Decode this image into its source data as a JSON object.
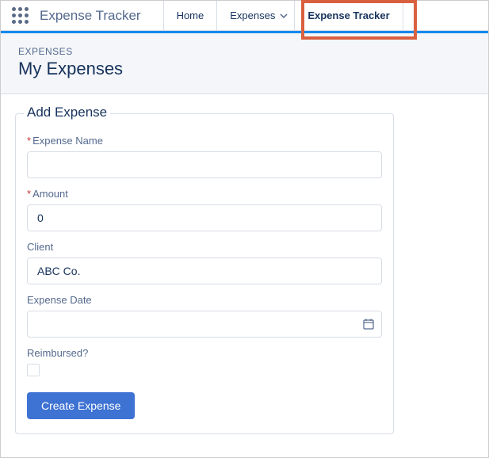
{
  "app": {
    "name": "Expense Tracker"
  },
  "nav": {
    "tabs": [
      {
        "label": "Home"
      },
      {
        "label": "Expenses"
      },
      {
        "label": "Expense Tracker"
      }
    ]
  },
  "pageHeader": {
    "eyebrow": "EXPENSES",
    "title": "My Expenses"
  },
  "form": {
    "legend": "Add Expense",
    "fields": {
      "expenseName": {
        "label": "Expense Name",
        "value": ""
      },
      "amount": {
        "label": "Amount",
        "value": "0"
      },
      "client": {
        "label": "Client",
        "value": "ABC Co."
      },
      "expenseDate": {
        "label": "Expense Date",
        "value": ""
      },
      "reimbursed": {
        "label": "Reimbursed?"
      }
    },
    "submitLabel": "Create Expense"
  }
}
